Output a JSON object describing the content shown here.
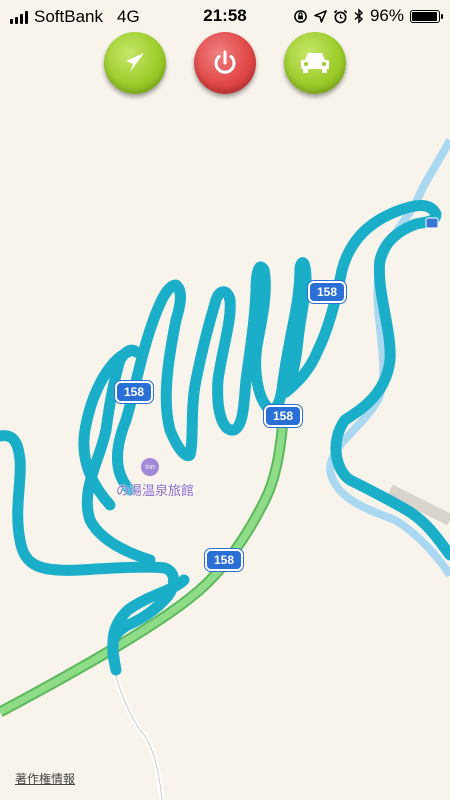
{
  "status_bar": {
    "carrier": "SoftBank",
    "network": "4G",
    "time": "21:58",
    "battery_percent": "96%",
    "battery_level": 0.96,
    "icons": [
      "signal-icon",
      "orientation-lock-icon",
      "location-arrow-icon",
      "alarm-icon",
      "bluetooth-icon",
      "battery-icon"
    ]
  },
  "controls": [
    {
      "name": "navigate-button",
      "icon": "navigation-arrow-icon",
      "color": "#9ccd2b"
    },
    {
      "name": "power-button",
      "icon": "power-icon",
      "color": "#e14848"
    },
    {
      "name": "car-button",
      "icon": "car-icon",
      "color": "#9ccd2b"
    }
  ],
  "map": {
    "route_labels": [
      "158",
      "158",
      "158",
      "158"
    ],
    "poi": {
      "icon": "hotel-icon",
      "icon_text": "Inn",
      "label": "の湯温泉旅館"
    },
    "copyright": "著作権情報",
    "colors": {
      "track": "#1aaec9",
      "highway": "#7fcf7a",
      "river": "#a9d8f0",
      "background": "#f8f4ec",
      "position_marker": "#a8d11a"
    }
  }
}
